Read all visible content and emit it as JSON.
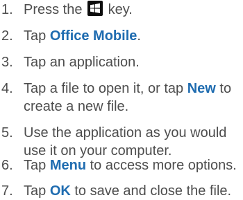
{
  "steps": [
    {
      "number": "1.",
      "before": "Press the",
      "after": "key.",
      "icon": "windows-key-icon"
    },
    {
      "number": "2.",
      "before": "Tap",
      "highlight": "Office Mobile",
      "after": "."
    },
    {
      "number": "3.",
      "text": "Tap an application."
    },
    {
      "number": "4.",
      "line1_before": "Tap a file to open it, or tap",
      "line1_highlight": "New",
      "line1_after": "to",
      "line2": "create a new file."
    },
    {
      "number": "5.",
      "line1": "Use the application as you would",
      "line2": "use it on your computer."
    },
    {
      "number": "6.",
      "before": "Tap",
      "highlight": "Menu",
      "after": "to access more options."
    },
    {
      "number": "7.",
      "before": "Tap",
      "highlight": "OK",
      "after": "to save and close the file."
    }
  ],
  "colors": {
    "text": "#4d4d4d",
    "highlight": "#1f6cb0"
  }
}
